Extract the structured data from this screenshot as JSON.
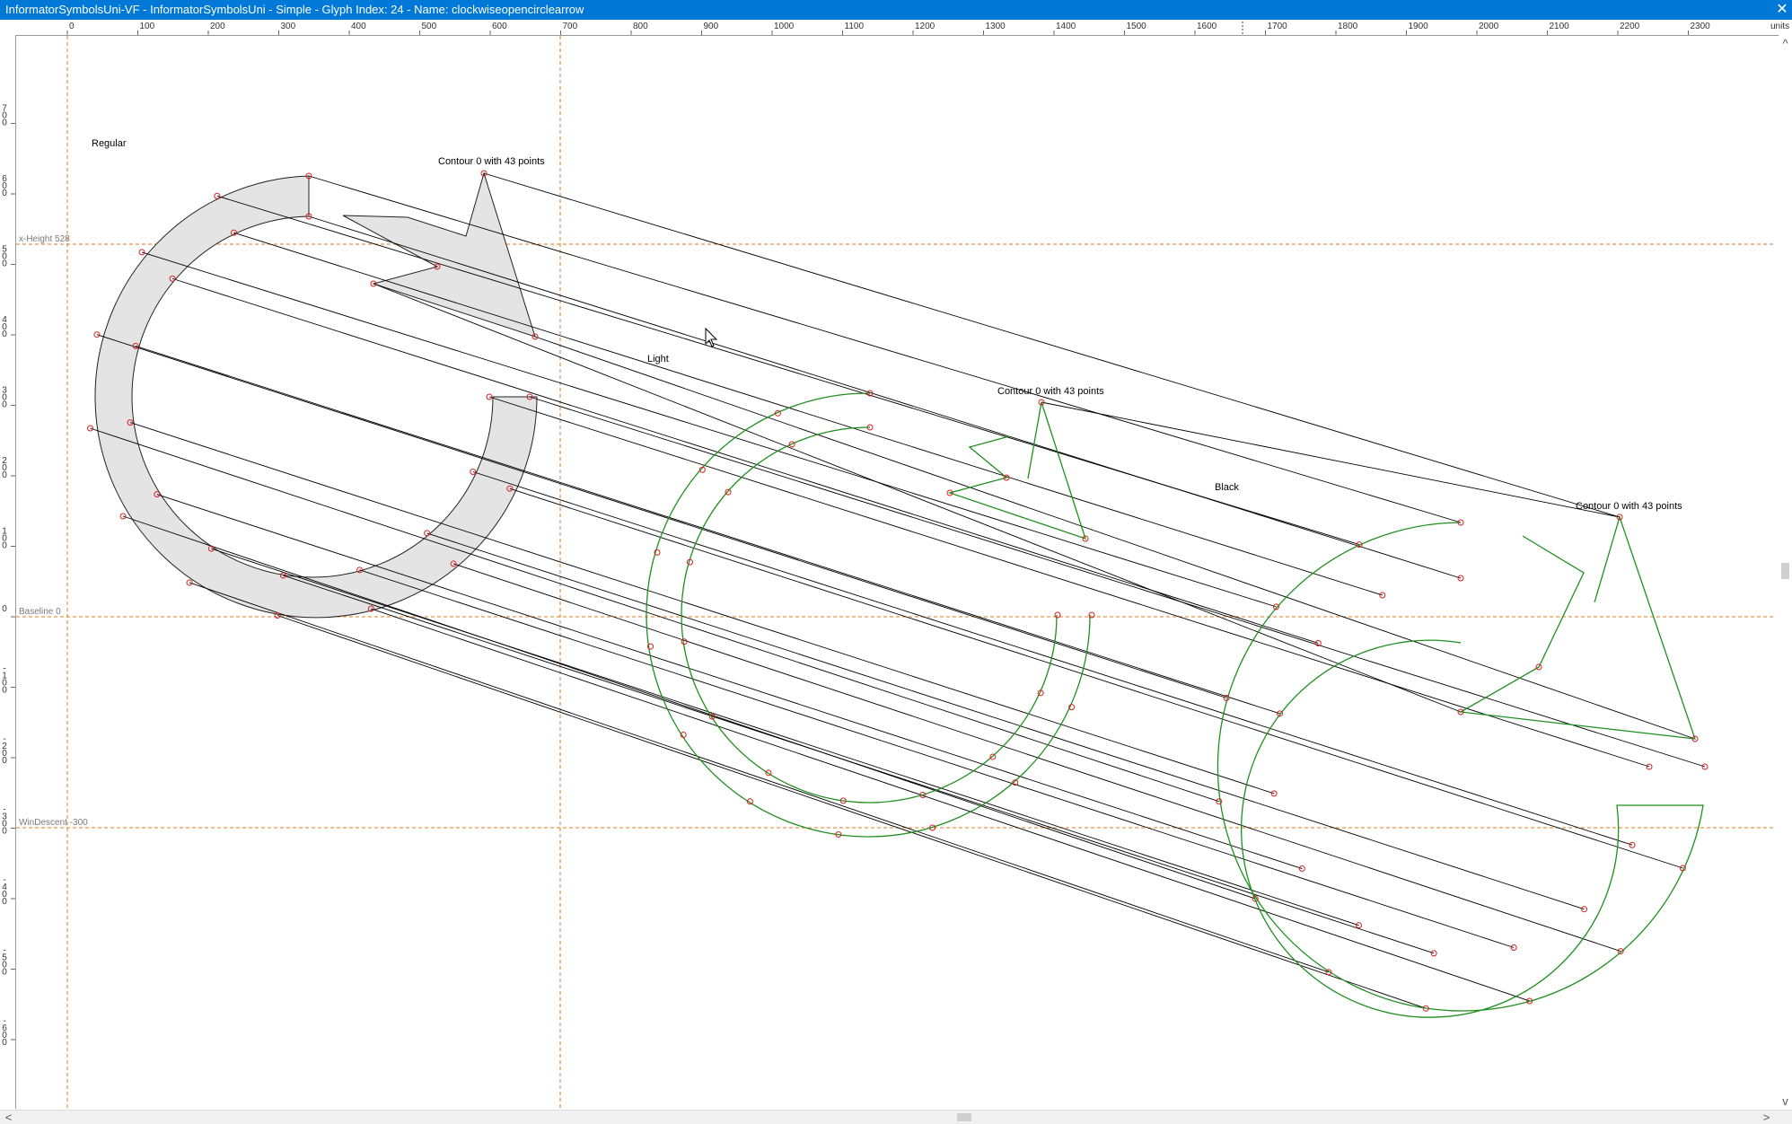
{
  "window": {
    "title": "InformatorSymbolsUni-VF - InformatorSymbolsUni - Simple - Glyph Index: 24 - Name: clockwiseopencirclearrow",
    "close_glyph": "✕"
  },
  "ruler": {
    "units_label": "units",
    "x_ticks": [
      "0",
      "100",
      "200",
      "300",
      "400",
      "500",
      "600",
      "700",
      "800",
      "900",
      "1000",
      "1100",
      "1200",
      "1300",
      "1400",
      "1500",
      "1600",
      "1700",
      "1800",
      "1900",
      "2000",
      "2100",
      "2200",
      "2300"
    ],
    "y_ticks": [
      "700",
      "600",
      "500",
      "400",
      "300",
      "200",
      "100",
      "0",
      "-100",
      "-200",
      "-300",
      "-400",
      "-500",
      "-600"
    ]
  },
  "guides": {
    "x_height": "x-Height 528",
    "baseline": "Baseline 0",
    "win_descent": "WinDescent -300"
  },
  "masters": {
    "regular": "Regular",
    "light": "Light",
    "black": "Black"
  },
  "contours": {
    "regular": "Contour 0 with 43 points",
    "light": "Contour 0 with 43 points",
    "black": "Contour 0 with 43 points"
  },
  "colors": {
    "titlebar": "#0078d7",
    "guide_line": "#e07b1f",
    "regular_fill": "#e4e4e4",
    "green_outline": "#1f8f1f",
    "point_red": "#d62020",
    "link_line": "#000000"
  },
  "scrollbars": {
    "left_arrow": "<",
    "right_arrow": ">",
    "up_arrow": "^",
    "down_arrow": "v"
  }
}
